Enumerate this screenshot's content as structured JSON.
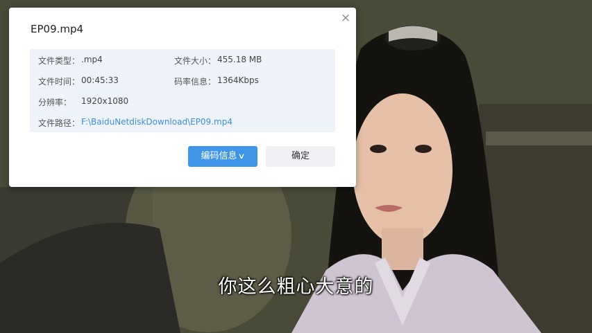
{
  "video": {
    "subtitle": "你这么粗心大意的"
  },
  "dialog": {
    "title": "EP09.mp4",
    "close_glyph": "×",
    "info": {
      "type_label": "文件类型：",
      "type_value": ".mp4",
      "size_label": "文件大小：",
      "size_value": "455.18 MB",
      "time_label": "文件时间：",
      "time_value": "00:45:33",
      "bitrate_label": "码率信息：",
      "bitrate_value": "1364Kbps",
      "resolution_label": "分辨率：",
      "resolution_value": "1920x1080",
      "path_label": "文件路径：",
      "path_value": "F:\\BaiduNetdiskDownload\\EP09.mp4"
    },
    "encode_button": "编码信息",
    "ok_button": "确定"
  },
  "colors": {
    "accent": "#3f95e8",
    "link": "#3b8fdc",
    "info_bg": "#eef2f9"
  }
}
